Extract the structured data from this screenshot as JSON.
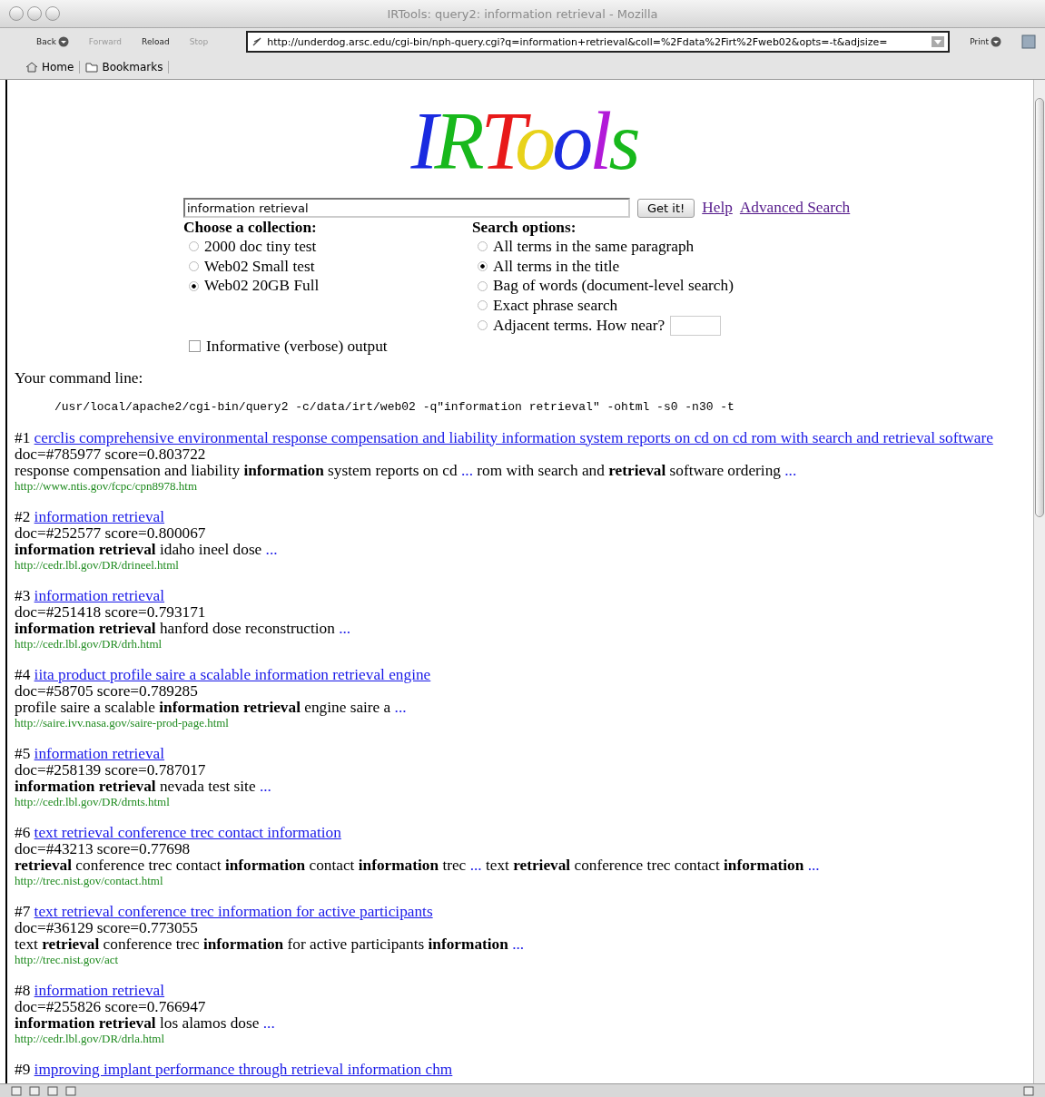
{
  "window": {
    "title": "IRTools: query2: information retrieval - Mozilla"
  },
  "toolbar": {
    "buttons": [
      {
        "label": "Back",
        "disabled": false,
        "menu": true
      },
      {
        "label": "Forward",
        "disabled": true,
        "menu": false
      },
      {
        "label": "Reload",
        "disabled": false,
        "menu": false
      },
      {
        "label": "Stop",
        "disabled": true,
        "menu": false
      }
    ],
    "address": "http://underdog.arsc.edu/cgi-bin/nph-query.cgi?q=information+retrieval&coll=%2Fdata%2Firt%2Fweb02&opts=-t&adjsize=",
    "print": "Print"
  },
  "bookmarks_bar": {
    "items": [
      {
        "label": "Home",
        "kind": "home"
      },
      {
        "label": "Bookmarks",
        "kind": "folder"
      }
    ]
  },
  "logo": {
    "letters": [
      {
        "text": "I",
        "color": "#1a2be0"
      },
      {
        "text": "R",
        "color": "#18b81c"
      },
      {
        "text": "T",
        "color": "#e81a1a"
      },
      {
        "text": "o",
        "color": "#e8d21a"
      },
      {
        "text": "o",
        "color": "#1a2be0"
      },
      {
        "text": "l",
        "color": "#b21ad8"
      },
      {
        "text": "s",
        "color": "#18b81c"
      }
    ]
  },
  "search": {
    "value": "information retrieval",
    "button": "Get it!",
    "links": [
      "Help",
      "Advanced Search"
    ]
  },
  "collections": {
    "heading": "Choose a collection:",
    "options": [
      {
        "label": "2000 doc tiny test",
        "selected": false
      },
      {
        "label": "Web02 Small test",
        "selected": false
      },
      {
        "label": "Web02 20GB Full",
        "selected": true
      }
    ]
  },
  "search_options": {
    "heading": "Search options:",
    "options": [
      {
        "label": "All terms in the same paragraph",
        "selected": false
      },
      {
        "label": "All terms in the title",
        "selected": true
      },
      {
        "label": "Bag of words (document-level search)",
        "selected": false
      },
      {
        "label": "Exact phrase search",
        "selected": false
      },
      {
        "label": "Adjacent terms. How near?",
        "selected": false,
        "has_field": true
      }
    ]
  },
  "verbose": {
    "label": "Informative (verbose) output",
    "checked": false
  },
  "command": {
    "label": "Your command line:",
    "line": "/usr/local/apache2/cgi-bin/query2 -c/data/irt/web02 -q\"information retrieval\" -ohtml -s0 -n30 -t"
  },
  "results": [
    {
      "rank": "#1",
      "title": "cerclis comprehensive environmental response compensation and liability information system reports on cd on cd rom with search and retrieval software",
      "meta": "doc=#785977 score=0.803722",
      "snippet": [
        {
          "kind": "text",
          "text": "response compensation and liability **information** system reports on cd"
        },
        {
          "kind": "more",
          "text": "..."
        },
        {
          "kind": "text",
          "text": "rom with search and **retrieval** software ordering"
        },
        {
          "kind": "more",
          "text": "..."
        }
      ],
      "url": "http://www.ntis.gov/fcpc/cpn8978.htm"
    },
    {
      "rank": "#2",
      "title": "information retrieval",
      "meta": "doc=#252577 score=0.800067",
      "snippet": [
        {
          "kind": "text",
          "text": "**information retrieval** idaho ineel dose"
        },
        {
          "kind": "more",
          "text": "..."
        }
      ],
      "url": "http://cedr.lbl.gov/DR/drineel.html"
    },
    {
      "rank": "#3",
      "title": "information retrieval",
      "meta": "doc=#251418 score=0.793171",
      "snippet": [
        {
          "kind": "text",
          "text": "**information retrieval** hanford dose reconstruction"
        },
        {
          "kind": "more",
          "text": "..."
        }
      ],
      "url": "http://cedr.lbl.gov/DR/drh.html"
    },
    {
      "rank": "#4",
      "title": "iita product profile saire a scalable information retrieval engine",
      "meta": "doc=#58705 score=0.789285",
      "snippet": [
        {
          "kind": "text",
          "text": "profile saire a scalable **information retrieval** engine saire a"
        },
        {
          "kind": "more",
          "text": "..."
        }
      ],
      "url": "http://saire.ivv.nasa.gov/saire-prod-page.html"
    },
    {
      "rank": "#5",
      "title": "information retrieval",
      "meta": "doc=#258139 score=0.787017",
      "snippet": [
        {
          "kind": "text",
          "text": "**information retrieval** nevada test site"
        },
        {
          "kind": "more",
          "text": "..."
        }
      ],
      "url": "http://cedr.lbl.gov/DR/drnts.html"
    },
    {
      "rank": "#6",
      "title": "text retrieval conference trec contact information",
      "meta": "doc=#43213 score=0.77698",
      "snippet": [
        {
          "kind": "text",
          "text": "**retrieval** conference trec contact **information** contact **information** trec"
        },
        {
          "kind": "more",
          "text": "..."
        },
        {
          "kind": "text",
          "text": "text **retrieval** conference trec contact **information**"
        },
        {
          "kind": "more",
          "text": "..."
        }
      ],
      "url": "http://trec.nist.gov/contact.html"
    },
    {
      "rank": "#7",
      "title": "text retrieval conference trec information for active participants",
      "meta": "doc=#36129 score=0.773055",
      "snippet": [
        {
          "kind": "text",
          "text": "text **retrieval** conference trec **information** for active participants **information**"
        },
        {
          "kind": "more",
          "text": "..."
        }
      ],
      "url": "http://trec.nist.gov/act"
    },
    {
      "rank": "#8",
      "title": "information retrieval",
      "meta": "doc=#255826 score=0.766947",
      "snippet": [
        {
          "kind": "text",
          "text": "**information retrieval** los alamos dose"
        },
        {
          "kind": "more",
          "text": "..."
        }
      ],
      "url": "http://cedr.lbl.gov/DR/drla.html"
    },
    {
      "rank": "#9",
      "title": "improving implant performance through retrieval information chm"
    }
  ]
}
